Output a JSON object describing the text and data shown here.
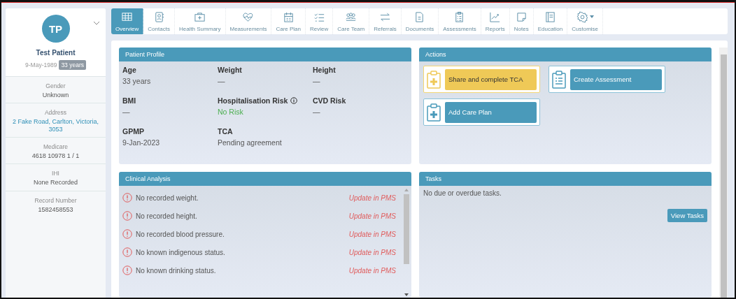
{
  "patient": {
    "initials": "TP",
    "name": "Test Patient",
    "dob": "9-May-1989",
    "age_badge": "33 years"
  },
  "details": [
    {
      "label": "Gender",
      "value": "Unknown",
      "link": false
    },
    {
      "label": "Address",
      "value": "2 Fake Road, Carlton, Victoria, 3053",
      "link": true
    },
    {
      "label": "Medicare",
      "value": "4618 10978 1 / 1",
      "link": false
    },
    {
      "label": "IHI",
      "value": "None Recorded",
      "link": false
    },
    {
      "label": "Record Number",
      "value": "1582458553",
      "link": false
    }
  ],
  "tabs": [
    {
      "label": "Overview",
      "selected": true
    },
    {
      "label": "Contacts",
      "selected": false
    },
    {
      "label": "Health Summary",
      "selected": false
    },
    {
      "label": "Measurements",
      "selected": false
    },
    {
      "label": "Care Plan",
      "selected": false
    },
    {
      "label": "Review",
      "selected": false
    },
    {
      "label": "Care Team",
      "selected": false
    },
    {
      "label": "Referrals",
      "selected": false
    },
    {
      "label": "Documents",
      "selected": false
    },
    {
      "label": "Assessments",
      "selected": false
    },
    {
      "label": "Reports",
      "selected": false
    },
    {
      "label": "Notes",
      "selected": false
    },
    {
      "label": "Education",
      "selected": false
    },
    {
      "label": "Customise",
      "selected": false
    }
  ],
  "patient_profile": {
    "title": "Patient Profile",
    "fields": [
      {
        "label": "Age",
        "value": "33 years"
      },
      {
        "label": "Weight",
        "value": "—"
      },
      {
        "label": "Height",
        "value": "—"
      },
      {
        "label": "BMI",
        "value": "—"
      },
      {
        "label": "Hospitalisation Risk",
        "value": "No Risk",
        "info": true,
        "positive": true
      },
      {
        "label": "CVD Risk",
        "value": "—"
      },
      {
        "label": "GPMP",
        "value": "9-Jan-2023"
      },
      {
        "label": "TCA",
        "value": "Pending agreement"
      }
    ]
  },
  "actions": {
    "title": "Actions",
    "items": [
      {
        "label": "Share and complete TCA",
        "kind": "share"
      },
      {
        "label": "Create Assessment",
        "kind": "assessment"
      },
      {
        "label": "Add Care Plan",
        "kind": "plan"
      }
    ]
  },
  "clinical_analysis": {
    "title": "Clinical Analysis",
    "items": [
      {
        "text": "No recorded weight.",
        "action": "Update in PMS"
      },
      {
        "text": "No recorded height.",
        "action": "Update in PMS"
      },
      {
        "text": "No recorded blood pressure.",
        "action": "Update in PMS"
      },
      {
        "text": "No known indigenous status.",
        "action": "Update in PMS"
      },
      {
        "text": "No known drinking status.",
        "action": "Update in PMS"
      }
    ]
  },
  "tasks": {
    "title": "Tasks",
    "message": "No due or overdue tasks.",
    "button": "View Tasks"
  }
}
